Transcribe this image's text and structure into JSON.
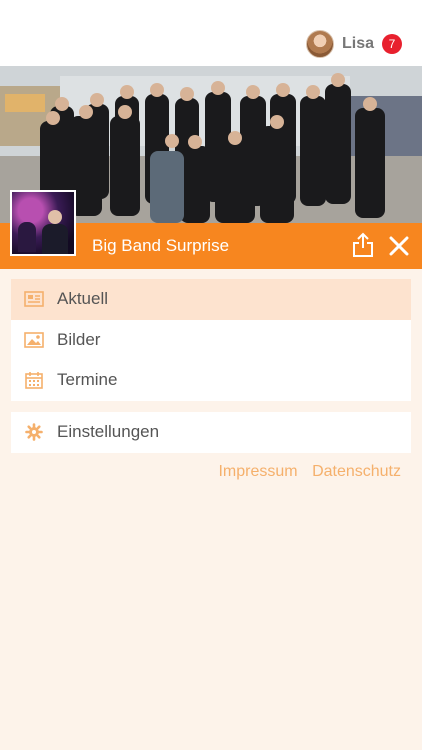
{
  "header": {
    "user_name": "Lisa",
    "notification_count": "7"
  },
  "band": {
    "name": "Big Band Surprise"
  },
  "menu": {
    "items": [
      {
        "label": "Aktuell",
        "icon": "newspaper-icon",
        "active": true
      },
      {
        "label": "Bilder",
        "icon": "image-icon",
        "active": false
      },
      {
        "label": "Termine",
        "icon": "calendar-icon",
        "active": false
      }
    ],
    "settings": {
      "label": "Einstellungen",
      "icon": "gear-icon"
    }
  },
  "footer_links": {
    "impressum": "Impressum",
    "datenschutz": "Datenschutz"
  },
  "colors": {
    "accent": "#f7861f",
    "background": "#fdf3ea",
    "active_item": "#fde3cf",
    "icon": "#f5b06c",
    "badge": "#e8202e"
  }
}
